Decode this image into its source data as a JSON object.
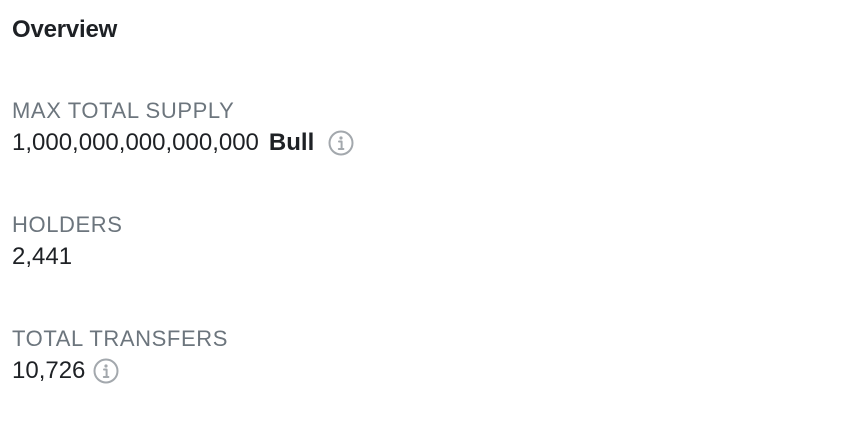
{
  "overview": {
    "title": "Overview",
    "stats": [
      {
        "label": "MAX TOTAL SUPPLY",
        "value": "1,000,000,000,000,000",
        "unit": "Bull",
        "icon": "info-circle-icon"
      },
      {
        "label": "HOLDERS",
        "value": "2,441"
      },
      {
        "label": "TOTAL TRANSFERS",
        "value": "10,726",
        "icon": "info-circle-icon"
      }
    ]
  },
  "colors": {
    "text_primary": "#1e2125",
    "text_secondary": "#6c757d",
    "icon": "#a3a8ad"
  }
}
